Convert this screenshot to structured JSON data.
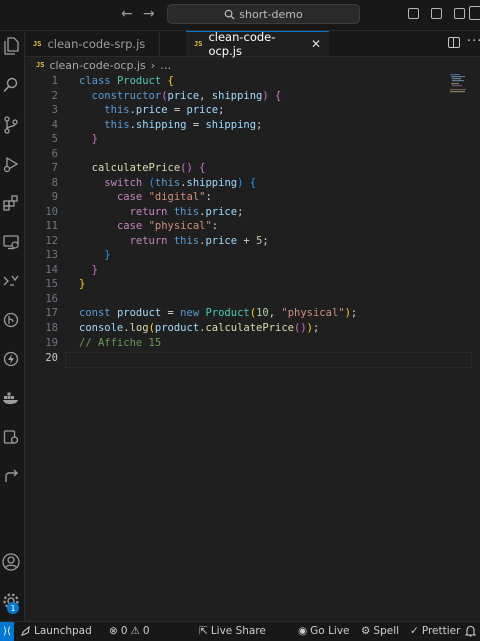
{
  "search": {
    "label": "short-demo"
  },
  "tabs": [
    {
      "label": "clean-code-srp.js",
      "icon": "js-file-icon"
    },
    {
      "label": "clean-code-ocp.js",
      "icon": "js-file-icon"
    }
  ],
  "breadcrumb": {
    "file": "clean-code-ocp.js",
    "more": "…"
  },
  "js_badge": "JS",
  "close_glyph": "✕",
  "editor": {
    "line_numbers": [
      "1",
      "2",
      "3",
      "4",
      "5",
      "6",
      "7",
      "8",
      "9",
      "10",
      "11",
      "12",
      "13",
      "14",
      "15",
      "16",
      "17",
      "18",
      "19",
      "20"
    ]
  },
  "statusbar": {
    "launchpad": "Launchpad",
    "errors": "0",
    "warnings": "0",
    "live_share": "Live Share",
    "go_live": "Go Live",
    "spell": "Spell",
    "prettier": "Prettier"
  },
  "notification_badge": "1",
  "colors": {
    "accent": "#0078d4",
    "background": "#1f1f1f"
  }
}
